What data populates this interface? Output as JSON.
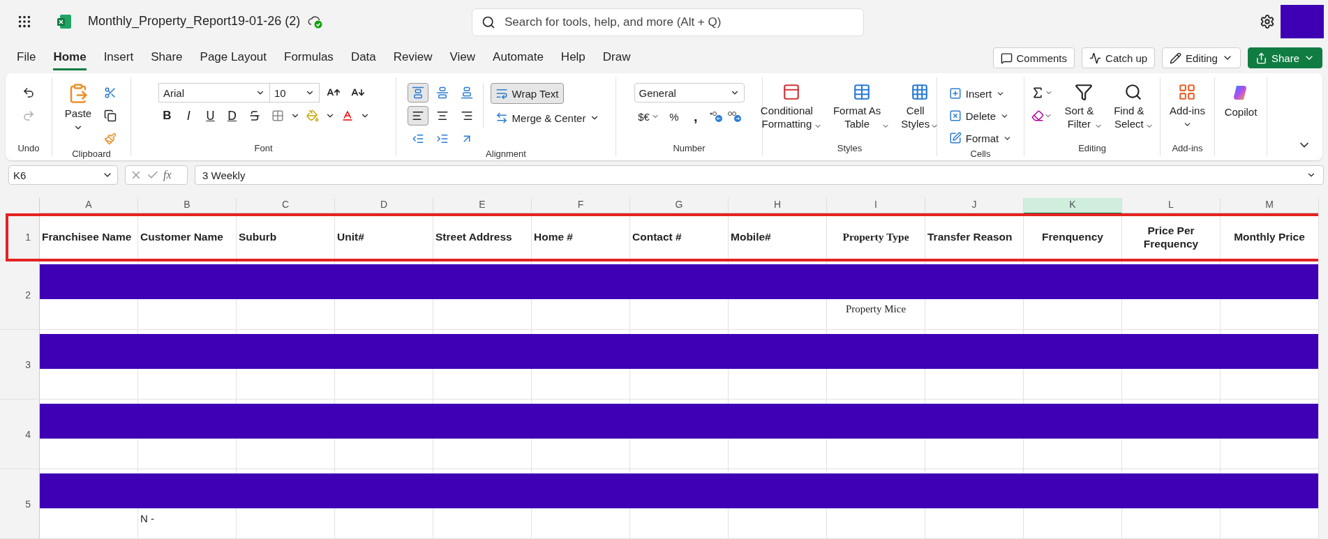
{
  "app_bar": {
    "file_name": "Monthly_Property_Report19-01-26 (2)",
    "search_placeholder": "Search for tools, help, and more (Alt + Q)"
  },
  "menu_tabs": [
    {
      "label": "File",
      "selected": false
    },
    {
      "label": "Home",
      "selected": true
    },
    {
      "label": "Insert",
      "selected": false
    },
    {
      "label": "Share",
      "selected": false
    },
    {
      "label": "Page Layout",
      "selected": false
    },
    {
      "label": "Formulas",
      "selected": false
    },
    {
      "label": "Data",
      "selected": false
    },
    {
      "label": "Review",
      "selected": false
    },
    {
      "label": "View",
      "selected": false
    },
    {
      "label": "Automate",
      "selected": false
    },
    {
      "label": "Help",
      "selected": false
    },
    {
      "label": "Draw",
      "selected": false
    }
  ],
  "header_buttons": [
    {
      "label": "Comments",
      "kind": "comments"
    },
    {
      "label": "Catch up",
      "kind": "catchup"
    },
    {
      "label": "Editing",
      "kind": "editing"
    },
    {
      "label": "Share",
      "kind": "share"
    }
  ],
  "ribbon": {
    "undo": {
      "label": "Undo"
    },
    "clipboard": {
      "label": "Clipboard",
      "paste": "Paste"
    },
    "font": {
      "label": "Font",
      "name": "Arial",
      "size": "10",
      "styles": [
        "B",
        "I",
        "U",
        "D"
      ]
    },
    "alignment": {
      "label": "Alignment",
      "vertical": [
        {
          "kind": "top",
          "selected": true
        },
        {
          "kind": "middle",
          "selected": false
        },
        {
          "kind": "bottom",
          "selected": false
        }
      ],
      "horizontal": [
        {
          "kind": "left",
          "selected": true
        },
        {
          "kind": "center",
          "selected": false
        },
        {
          "kind": "right",
          "selected": false
        }
      ],
      "wrap_text": {
        "label": "Wrap Text",
        "selected": true
      },
      "merge": "Merge & Center"
    },
    "number": {
      "label": "Number",
      "format": "General",
      "currency": "$€",
      "percent": "%",
      "comma": ","
    },
    "styles": {
      "label": "Styles",
      "buttons": [
        {
          "kind": "conditional",
          "lines": [
            "Conditional",
            "Formatting"
          ]
        },
        {
          "kind": "table",
          "lines": [
            "Format As",
            "Table"
          ]
        },
        {
          "kind": "cell",
          "lines": [
            "Cell",
            "Styles"
          ]
        }
      ]
    },
    "cells": {
      "label": "Cells",
      "buttons": [
        {
          "kind": "insert",
          "label": "Insert"
        },
        {
          "kind": "delete",
          "label": "Delete"
        },
        {
          "kind": "format",
          "label": "Format"
        }
      ]
    },
    "editing": {
      "label": "Editing",
      "buttons": [
        {
          "kind": "sort",
          "lines": [
            "Sort &",
            "Filter"
          ]
        },
        {
          "kind": "find",
          "lines": [
            "Find &",
            "Select"
          ]
        }
      ]
    },
    "addins": {
      "label": "Add-ins",
      "button": "Add-ins"
    },
    "copilot": {
      "button": "Copilot"
    }
  },
  "formula_bar": {
    "name_box": "K6",
    "fx": "fx",
    "formula": "3 Weekly"
  },
  "sheet": {
    "columns": [
      {
        "letter": "A",
        "selected": false
      },
      {
        "letter": "B",
        "selected": false
      },
      {
        "letter": "C",
        "selected": false
      },
      {
        "letter": "D",
        "selected": false
      },
      {
        "letter": "E",
        "selected": false
      },
      {
        "letter": "F",
        "selected": false
      },
      {
        "letter": "G",
        "selected": false
      },
      {
        "letter": "H",
        "selected": false
      },
      {
        "letter": "I",
        "selected": false
      },
      {
        "letter": "J",
        "selected": false
      },
      {
        "letter": "K",
        "selected": true
      },
      {
        "letter": "L",
        "selected": false
      },
      {
        "letter": "M",
        "selected": false
      }
    ],
    "header_row": {
      "number": "1",
      "cells": [
        "Franchisee Name",
        "Customer Name",
        "Suburb",
        "Unit#",
        "Street Address",
        "Home #",
        "Contact #",
        "Mobile#",
        "Property Type",
        "Transfer Reason",
        "Frenquency",
        "Price Per Frequency",
        "Monthly Price"
      ]
    },
    "rows": [
      {
        "number": "2",
        "redacted": true,
        "cells": {
          "col_i": "Property Mice"
        }
      },
      {
        "number": "3",
        "redacted": true,
        "cells": {}
      },
      {
        "number": "4",
        "redacted": true,
        "cells": {}
      },
      {
        "number": "5",
        "redacted": true,
        "cells": {
          "col_b": "N -"
        }
      }
    ]
  }
}
